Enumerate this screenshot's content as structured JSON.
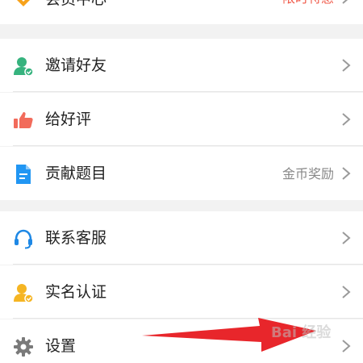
{
  "menu": {
    "member": {
      "label": "会员中心",
      "right_text": "限时特惠",
      "icon": "diamond-icon"
    },
    "invite": {
      "label": "邀请好友",
      "icon": "add-user-icon"
    },
    "rate": {
      "label": "给好评",
      "icon": "thumbs-up-icon"
    },
    "contribute": {
      "label": "贡献题目",
      "right_text": "金币奖励",
      "icon": "document-icon"
    },
    "support": {
      "label": "联系客服",
      "icon": "headset-icon"
    },
    "realname": {
      "label": "实名认证",
      "icon": "verified-user-icon"
    },
    "settings": {
      "label": "设置",
      "icon": "gear-icon"
    }
  },
  "watermark": {
    "text": "Bai 经验"
  },
  "colors": {
    "accent_orange": "#f7a21b",
    "promo_red": "#f05a4a",
    "invite_green": "#36b37e",
    "rate_red": "#f26b5b",
    "doc_blue": "#2196f3",
    "support_blue": "#1e88e5",
    "realname_yellow": "#f5b523",
    "settings_gray": "#7a7a7a",
    "arrow_red": "#e8262b"
  }
}
